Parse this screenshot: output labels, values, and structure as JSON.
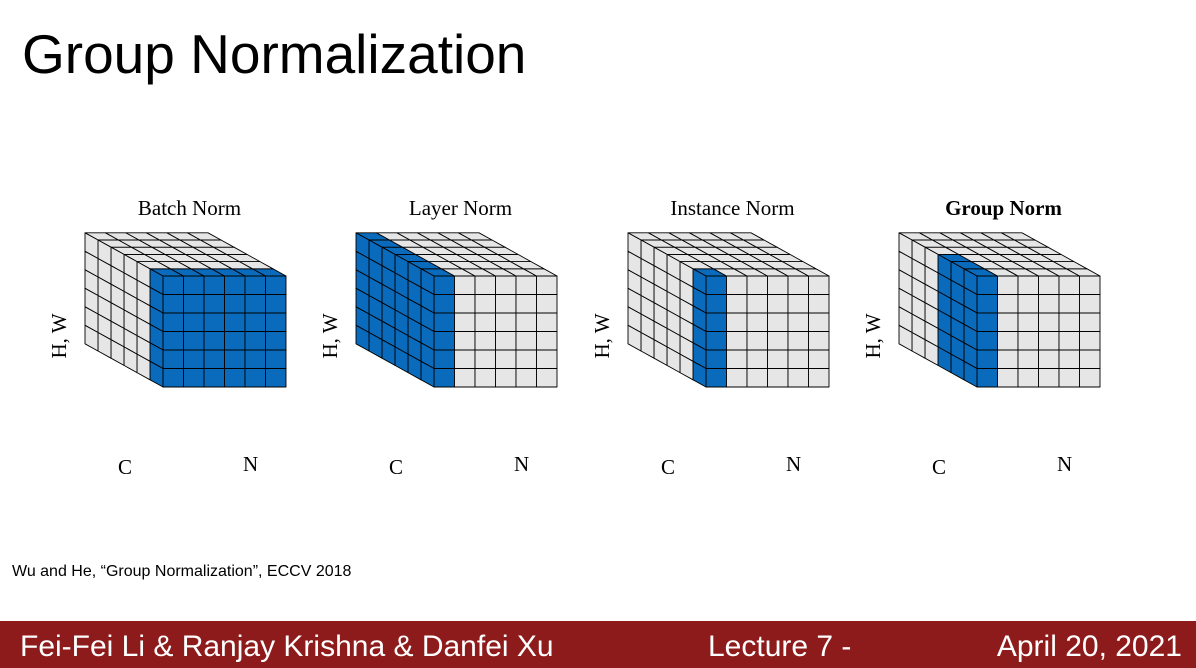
{
  "slide": {
    "title": "Group Normalization",
    "citation": "Wu and He, “Group Normalization”, ECCV 2018"
  },
  "figure": {
    "panels": [
      {
        "title": "Batch Norm",
        "bold": false,
        "highlight": "batch",
        "labels": {
          "hw": "H, W",
          "c": "C",
          "n": "N"
        }
      },
      {
        "title": "Layer Norm",
        "bold": false,
        "highlight": "layer",
        "labels": {
          "hw": "H, W",
          "c": "C",
          "n": "N"
        }
      },
      {
        "title": "Instance Norm",
        "bold": false,
        "highlight": "instance",
        "labels": {
          "hw": "H, W",
          "c": "C",
          "n": "N"
        }
      },
      {
        "title": "Group Norm",
        "bold": true,
        "highlight": "group",
        "labels": {
          "hw": "H, W",
          "c": "C",
          "n": "N"
        }
      }
    ],
    "colors": {
      "highlight": "#0a6bbd",
      "cell": "#e6e6e6",
      "edge": "#000000"
    }
  },
  "footer": {
    "authors": "Fei-Fei Li & Ranjay Krishna & Danfei Xu",
    "lecture": "Lecture 7 -",
    "date": "April 20, 2021",
    "background": "#8e1b1b"
  }
}
